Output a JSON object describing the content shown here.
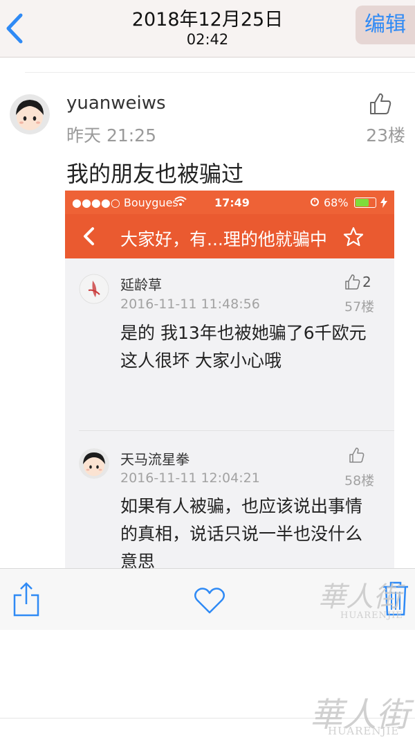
{
  "topbar": {
    "date": "2018年12月25日",
    "time": "02:42",
    "edit_label": "编辑"
  },
  "post": {
    "username": "yuanweiws",
    "time": "昨天 21:25",
    "floor": "23楼",
    "text": "我的朋友也被骗过"
  },
  "embedded": {
    "status": {
      "carrier": "●●●●○ Bouygues",
      "time": "17:49",
      "battery": "68%",
      "battery_level": 0.68
    },
    "nav_title": "大家好，有...理的他就骗中",
    "comments": [
      {
        "name": "延龄草",
        "time": "2016-11-11 11:48:56",
        "likes": "2",
        "floor": "57楼",
        "lines": [
          "是的 我13年也被她骗了6千欧元",
          "这人很坏 大家小心哦"
        ]
      },
      {
        "name": "天马流星拳",
        "time": "2016-11-11 12:04:21",
        "likes": "",
        "floor": "58楼",
        "lines": [
          "如果有人被骗，也应该说出事情",
          "的真相，说话只说一半也没什么",
          "意思"
        ]
      }
    ]
  },
  "toolbar": {
    "icons": [
      "share-icon",
      "heart-icon",
      "trash-icon"
    ]
  },
  "watermark": {
    "brand_cn": "華人街",
    "brand_en": "HUARENJIE"
  },
  "colors": {
    "accent_blue": "#2f8af5",
    "embed_orange": "#ea5a30"
  }
}
